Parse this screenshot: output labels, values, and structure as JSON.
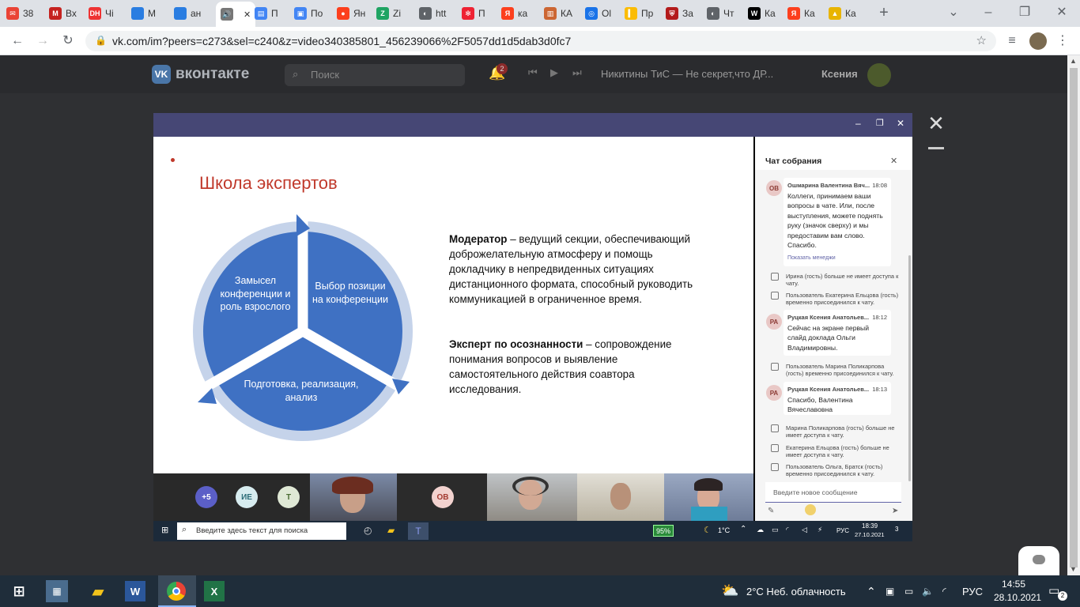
{
  "browser": {
    "tabs": [
      {
        "label": "38",
        "fav": "#ea4335",
        "letter": "✉"
      },
      {
        "label": "Вх",
        "fav": "#c5221f",
        "letter": "M"
      },
      {
        "label": "Чі",
        "fav": "#e33",
        "letter": "DH"
      },
      {
        "label": "М",
        "fav": "#2a7de1",
        "letter": ""
      },
      {
        "label": "ан",
        "fav": "#2a7de1",
        "letter": ""
      },
      {
        "label": "",
        "fav": "#777",
        "letter": "🔊"
      },
      {
        "label": "П",
        "fav": "#4285f4",
        "letter": "▤"
      },
      {
        "label": "По",
        "fav": "#4285f4",
        "letter": "▣"
      },
      {
        "label": "Ян",
        "fav": "#fc3f1d",
        "letter": "●"
      },
      {
        "label": "Zi",
        "fav": "#1fa463",
        "letter": "Z"
      },
      {
        "label": "htt",
        "fav": "#5f6368",
        "letter": "◐"
      },
      {
        "label": "П",
        "fav": "#e23",
        "letter": "✻"
      },
      {
        "label": "ка",
        "fav": "#fc3f1d",
        "letter": "Я"
      },
      {
        "label": "КА",
        "fav": "#c63",
        "letter": "▥"
      },
      {
        "label": "Ol",
        "fav": "#1a73e8",
        "letter": "◎"
      },
      {
        "label": "Пр",
        "fav": "#fbbc04",
        "letter": "▍"
      },
      {
        "label": "За",
        "fav": "#b31b1b",
        "letter": "⛨"
      },
      {
        "label": "Чт",
        "fav": "#5f6368",
        "letter": "◐"
      },
      {
        "label": "Ка",
        "fav": "#000",
        "letter": "W"
      },
      {
        "label": "Ка",
        "fav": "#fc3f1d",
        "letter": "Я"
      },
      {
        "label": "Ка",
        "fav": "#e8b400",
        "letter": "▲"
      }
    ],
    "url": "vk.com/im?peers=c273&sel=c240&z=video340385801_456239066%2F5057dd1d5dab3d0fc7"
  },
  "vk": {
    "logo": "вконтакте",
    "search_placeholder": "Поиск",
    "notifications_count": "2",
    "track": "Никитины ТиС — Не секрет,что ДР...",
    "user": "Ксения"
  },
  "slide": {
    "title": "Школа экспертов",
    "cycle": [
      "Замысел конференции и роль взрослого",
      "Выбор позиции на конференции",
      "Подготовка, реализация, анализ"
    ],
    "moderator_bold": "Модератор",
    "moderator_text": " – ведущий секции, обеспечивающий доброжелательную атмосферу и помощь докладчику в непредвиденных ситуациях дистанционного формата, способный руководить коммуникацией в ограниченное время.",
    "expert_bold": "Эксперт по осознанности",
    "expert_text": " – сопровождение понимания вопросов и выявление самостоятельного действия соавтора исследования."
  },
  "chat": {
    "title": "Чат собрания",
    "messages": [
      {
        "avatar": "ОВ",
        "name": "Ошмарина Валентина Вяч...",
        "time": "18:08",
        "text": "Коллеги, принимаем ваши вопросы в чате. Или, после выступления, можете поднять руку (значок сверху) и мы предоставим вам слово. Спасибо.",
        "link": "Показать менеджи"
      },
      {
        "avatar": "РА",
        "name": "Руцкая Ксения Анатольев...",
        "time": "18:12",
        "text": "Сейчас на экране первый слайд доклада Ольги Владимировны."
      },
      {
        "avatar": "РА",
        "name": "Руцкая Ксения Анатольев...",
        "time": "18:13",
        "text": "Спасибо, Валентина Вячеславовна"
      }
    ],
    "system": [
      "Ирина (гость) больше не имеет доступа к чату.",
      "Пользователь Екатерина Ельцова (гость) временно присоединился к чату.",
      "Пользователь Марина Поликарпова (гость) временно присоединился к чату.",
      "Марина Поликарпова (гость) больше не имеет доступа к чату.",
      "Екатерина Ельцова (гость) больше не имеет доступа к чату.",
      "Пользователь Ольга, Братск (гость) временно присоединился к чату."
    ],
    "input_placeholder": "Введите новое сообщение"
  },
  "participants": [
    {
      "label": "+5",
      "bg": "#5b5fc7",
      "fg": "#ffffff"
    },
    {
      "label": "ИЕ",
      "bg": "#d7ecef",
      "fg": "#2d6d78"
    },
    {
      "label": "Т",
      "bg": "#dfe8d5",
      "fg": "#4a6b32"
    },
    {
      "label": "ОВ",
      "bg": "#f2d2cf",
      "fg": "#a33a31"
    }
  ],
  "inner_taskbar": {
    "search_placeholder": "Введите здесь текст для поиска",
    "battery": "95%",
    "weather": "1°C",
    "lang": "РУС",
    "time": "18:39",
    "date": "27.10.2021",
    "notif": "3"
  },
  "taskbar": {
    "weather": "2°C  Неб. облачность",
    "lang": "РУС",
    "time": "14:55",
    "date": "28.10.2021",
    "notif": "2"
  },
  "colors": {
    "teams": "#464775",
    "accent": "#4472c4",
    "vk": "#2a2b2e"
  }
}
